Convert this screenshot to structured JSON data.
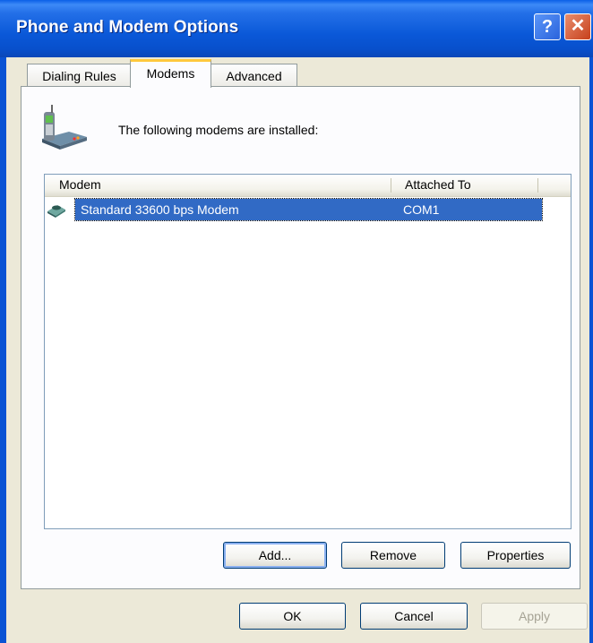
{
  "window": {
    "title": "Phone and Modem Options"
  },
  "tabs": [
    {
      "label": "Dialing Rules"
    },
    {
      "label": "Modems"
    },
    {
      "label": "Advanced"
    }
  ],
  "panel": {
    "intro": "The following modems are  installed:"
  },
  "modem_list": {
    "columns": [
      "Modem",
      "Attached To"
    ],
    "rows": [
      {
        "modem": "Standard 33600 bps Modem",
        "attached_to": "COM1",
        "selected": true
      }
    ]
  },
  "list_buttons": {
    "add": "Add...",
    "remove": "Remove",
    "properties": "Properties"
  },
  "dialog_buttons": {
    "ok": "OK",
    "cancel": "Cancel",
    "apply": "Apply"
  },
  "icons": {
    "help": "?",
    "close": "✕",
    "header": "phone-modem-icon",
    "row": "modem-icon"
  },
  "colors": {
    "titlebar": "#0a58d8",
    "selection": "#316ac5",
    "active_tab_accent": "#ffc83c"
  }
}
